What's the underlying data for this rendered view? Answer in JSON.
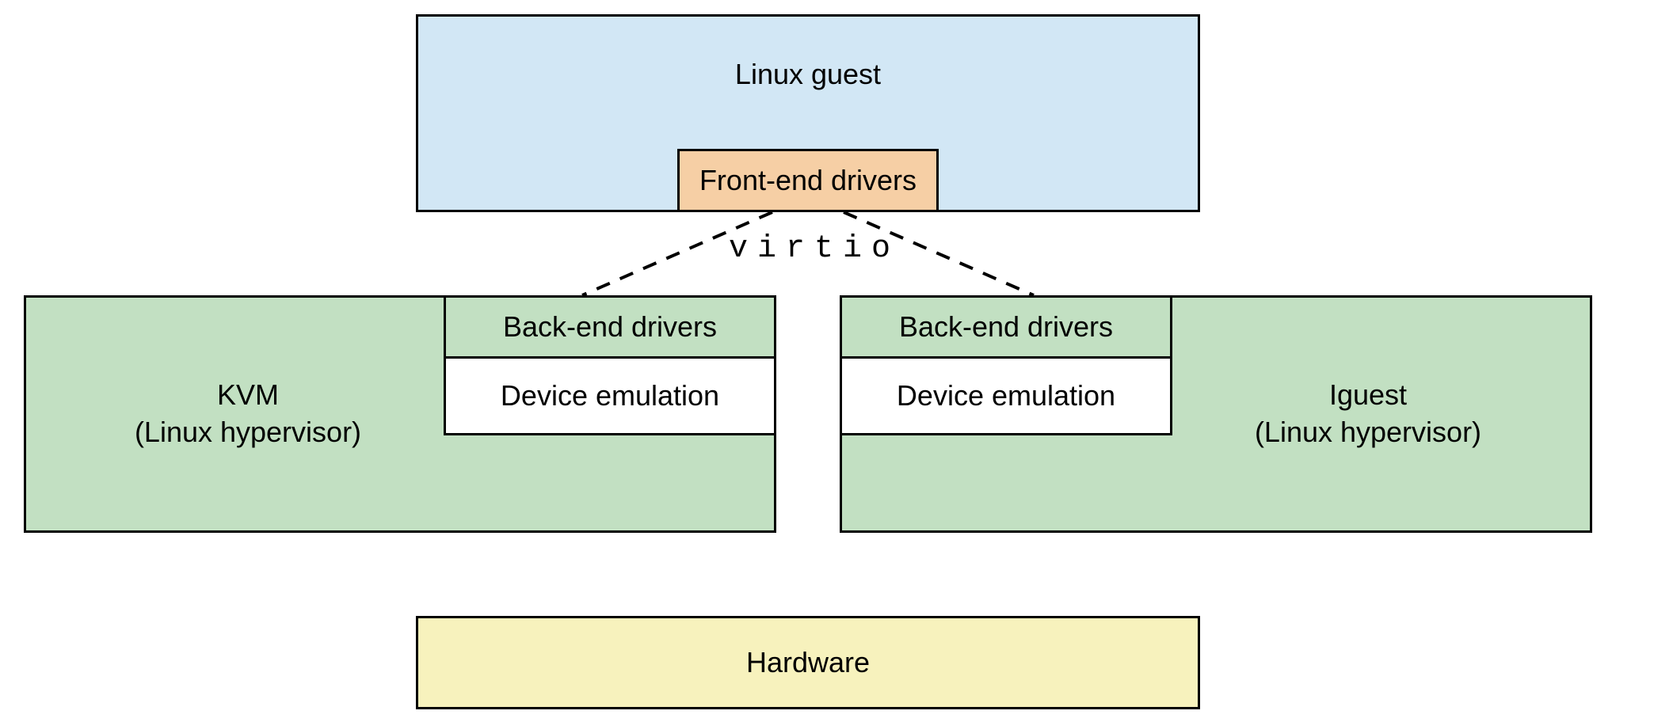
{
  "guest": {
    "title": "Linux guest",
    "frontend": "Front-end drivers"
  },
  "virtio_label": "virtio",
  "left_hyp": {
    "title": "KVM\n(Linux hypervisor)",
    "backend": "Back-end drivers",
    "devemu": "Device emulation"
  },
  "right_hyp": {
    "title": "Iguest\n(Linux hypervisor)",
    "backend": "Back-end drivers",
    "devemu": "Device emulation"
  },
  "hardware": {
    "title": "Hardware"
  }
}
